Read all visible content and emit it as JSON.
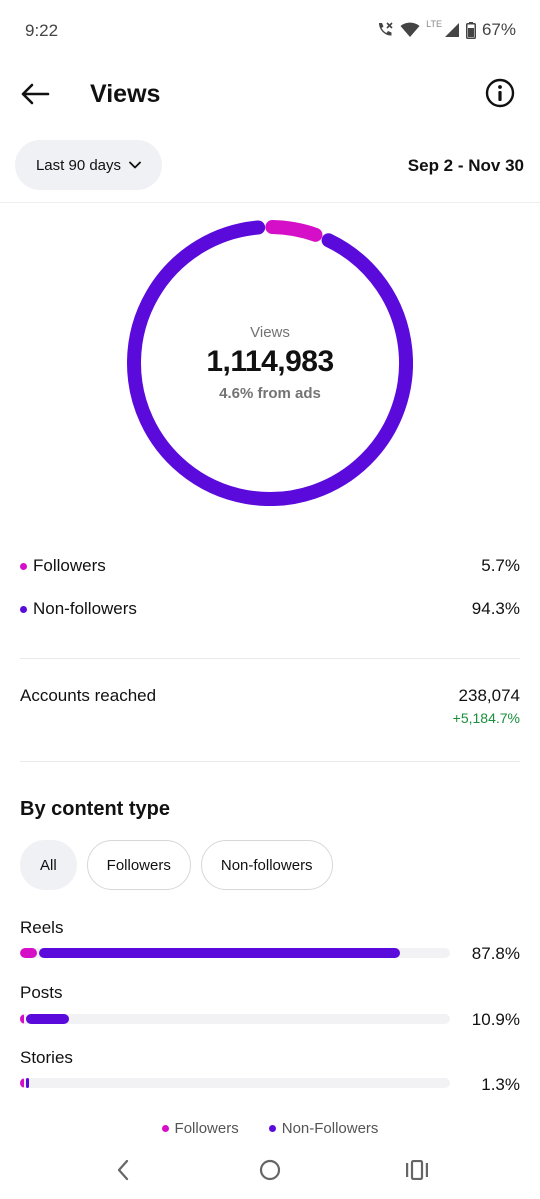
{
  "status_bar": {
    "time": "9:22",
    "network": "LTE",
    "battery": "67%"
  },
  "header": {
    "title": "Views"
  },
  "range": {
    "dropdown_label": "Last 90 days",
    "dates": "Sep 2 - Nov 30"
  },
  "summary": {
    "label": "Views",
    "total": "1,114,983",
    "ads_note": "4.6% from ads",
    "followers_share": 0.057,
    "non_followers_share": 0.943
  },
  "audience": [
    {
      "label": "Followers",
      "value": "5.7%",
      "color": "#d50fc8"
    },
    {
      "label": "Non-followers",
      "value": "94.3%",
      "color": "#5a0bdc"
    }
  ],
  "reach": {
    "label": "Accounts reached",
    "value": "238,074",
    "change": "+5,184.7%"
  },
  "content_type": {
    "title": "By content type",
    "filters": [
      "All",
      "Followers",
      "Non-followers"
    ],
    "active_filter": "All",
    "rows": [
      {
        "label": "Reels",
        "value": "87.8%",
        "followers_frac": 0.04,
        "nonfollowers_frac": 0.838
      },
      {
        "label": "Posts",
        "value": "10.9%",
        "followers_frac": 0.01,
        "nonfollowers_frac": 0.099
      },
      {
        "label": "Stories",
        "value": "1.3%",
        "followers_frac": 0.008,
        "nonfollowers_frac": 0.005
      }
    ]
  },
  "legend": {
    "followers": "Followers",
    "non_followers": "Non-Followers"
  },
  "colors": {
    "followers": "#d50fc8",
    "non_followers": "#5a0bdc",
    "positive_change": "#1a8f3c"
  }
}
